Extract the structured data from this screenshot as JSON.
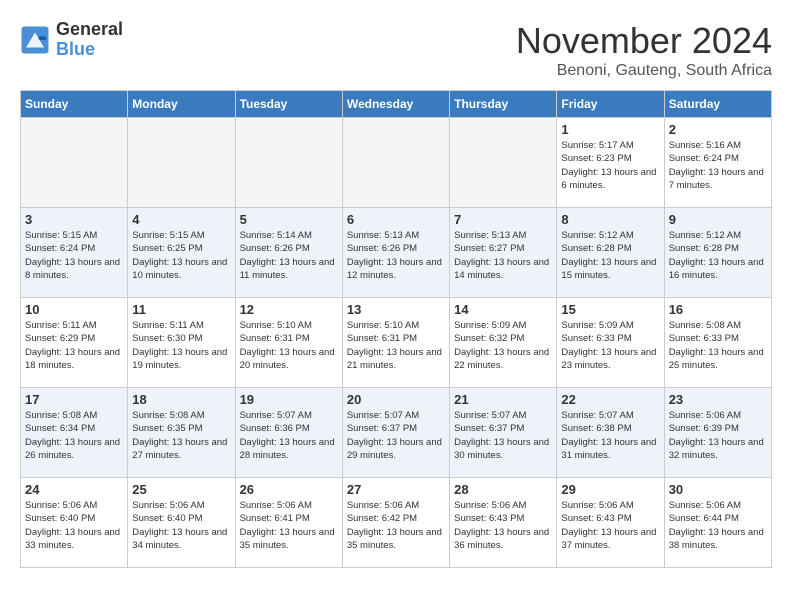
{
  "header": {
    "logo_line1": "General",
    "logo_line2": "Blue",
    "month": "November 2024",
    "location": "Benoni, Gauteng, South Africa"
  },
  "weekdays": [
    "Sunday",
    "Monday",
    "Tuesday",
    "Wednesday",
    "Thursday",
    "Friday",
    "Saturday"
  ],
  "weeks": [
    [
      {
        "day": "",
        "info": ""
      },
      {
        "day": "",
        "info": ""
      },
      {
        "day": "",
        "info": ""
      },
      {
        "day": "",
        "info": ""
      },
      {
        "day": "",
        "info": ""
      },
      {
        "day": "1",
        "info": "Sunrise: 5:17 AM\nSunset: 6:23 PM\nDaylight: 13 hours and 6 minutes."
      },
      {
        "day": "2",
        "info": "Sunrise: 5:16 AM\nSunset: 6:24 PM\nDaylight: 13 hours and 7 minutes."
      }
    ],
    [
      {
        "day": "3",
        "info": "Sunrise: 5:15 AM\nSunset: 6:24 PM\nDaylight: 13 hours and 8 minutes."
      },
      {
        "day": "4",
        "info": "Sunrise: 5:15 AM\nSunset: 6:25 PM\nDaylight: 13 hours and 10 minutes."
      },
      {
        "day": "5",
        "info": "Sunrise: 5:14 AM\nSunset: 6:26 PM\nDaylight: 13 hours and 11 minutes."
      },
      {
        "day": "6",
        "info": "Sunrise: 5:13 AM\nSunset: 6:26 PM\nDaylight: 13 hours and 12 minutes."
      },
      {
        "day": "7",
        "info": "Sunrise: 5:13 AM\nSunset: 6:27 PM\nDaylight: 13 hours and 14 minutes."
      },
      {
        "day": "8",
        "info": "Sunrise: 5:12 AM\nSunset: 6:28 PM\nDaylight: 13 hours and 15 minutes."
      },
      {
        "day": "9",
        "info": "Sunrise: 5:12 AM\nSunset: 6:28 PM\nDaylight: 13 hours and 16 minutes."
      }
    ],
    [
      {
        "day": "10",
        "info": "Sunrise: 5:11 AM\nSunset: 6:29 PM\nDaylight: 13 hours and 18 minutes."
      },
      {
        "day": "11",
        "info": "Sunrise: 5:11 AM\nSunset: 6:30 PM\nDaylight: 13 hours and 19 minutes."
      },
      {
        "day": "12",
        "info": "Sunrise: 5:10 AM\nSunset: 6:31 PM\nDaylight: 13 hours and 20 minutes."
      },
      {
        "day": "13",
        "info": "Sunrise: 5:10 AM\nSunset: 6:31 PM\nDaylight: 13 hours and 21 minutes."
      },
      {
        "day": "14",
        "info": "Sunrise: 5:09 AM\nSunset: 6:32 PM\nDaylight: 13 hours and 22 minutes."
      },
      {
        "day": "15",
        "info": "Sunrise: 5:09 AM\nSunset: 6:33 PM\nDaylight: 13 hours and 23 minutes."
      },
      {
        "day": "16",
        "info": "Sunrise: 5:08 AM\nSunset: 6:33 PM\nDaylight: 13 hours and 25 minutes."
      }
    ],
    [
      {
        "day": "17",
        "info": "Sunrise: 5:08 AM\nSunset: 6:34 PM\nDaylight: 13 hours and 26 minutes."
      },
      {
        "day": "18",
        "info": "Sunrise: 5:08 AM\nSunset: 6:35 PM\nDaylight: 13 hours and 27 minutes."
      },
      {
        "day": "19",
        "info": "Sunrise: 5:07 AM\nSunset: 6:36 PM\nDaylight: 13 hours and 28 minutes."
      },
      {
        "day": "20",
        "info": "Sunrise: 5:07 AM\nSunset: 6:37 PM\nDaylight: 13 hours and 29 minutes."
      },
      {
        "day": "21",
        "info": "Sunrise: 5:07 AM\nSunset: 6:37 PM\nDaylight: 13 hours and 30 minutes."
      },
      {
        "day": "22",
        "info": "Sunrise: 5:07 AM\nSunset: 6:38 PM\nDaylight: 13 hours and 31 minutes."
      },
      {
        "day": "23",
        "info": "Sunrise: 5:06 AM\nSunset: 6:39 PM\nDaylight: 13 hours and 32 minutes."
      }
    ],
    [
      {
        "day": "24",
        "info": "Sunrise: 5:06 AM\nSunset: 6:40 PM\nDaylight: 13 hours and 33 minutes."
      },
      {
        "day": "25",
        "info": "Sunrise: 5:06 AM\nSunset: 6:40 PM\nDaylight: 13 hours and 34 minutes."
      },
      {
        "day": "26",
        "info": "Sunrise: 5:06 AM\nSunset: 6:41 PM\nDaylight: 13 hours and 35 minutes."
      },
      {
        "day": "27",
        "info": "Sunrise: 5:06 AM\nSunset: 6:42 PM\nDaylight: 13 hours and 35 minutes."
      },
      {
        "day": "28",
        "info": "Sunrise: 5:06 AM\nSunset: 6:43 PM\nDaylight: 13 hours and 36 minutes."
      },
      {
        "day": "29",
        "info": "Sunrise: 5:06 AM\nSunset: 6:43 PM\nDaylight: 13 hours and 37 minutes."
      },
      {
        "day": "30",
        "info": "Sunrise: 5:06 AM\nSunset: 6:44 PM\nDaylight: 13 hours and 38 minutes."
      }
    ]
  ]
}
